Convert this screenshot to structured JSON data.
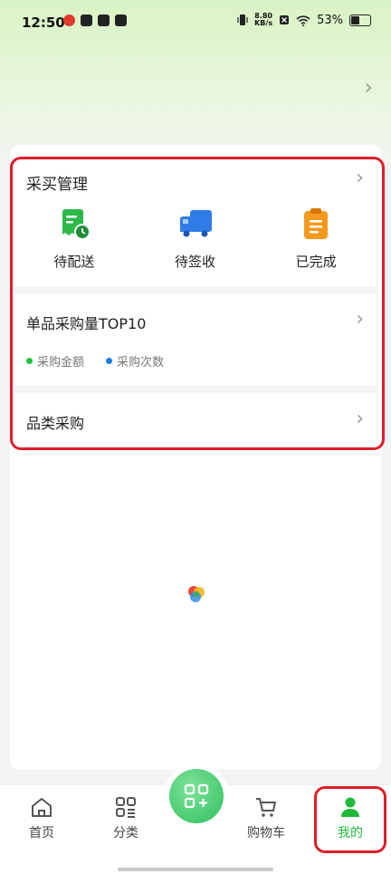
{
  "status_bar": {
    "time": "12:50",
    "net_speed_value": "8.80",
    "net_speed_unit": "KB/s",
    "battery": "53%"
  },
  "purchase_card": {
    "title": "采买管理",
    "items": [
      {
        "label": "待配送",
        "icon": "delivery-receipt-icon",
        "color": "#2db84a"
      },
      {
        "label": "待签收",
        "icon": "truck-icon",
        "color": "#2f7be8"
      },
      {
        "label": "已完成",
        "icon": "clipboard-icon",
        "color": "#f39a1e"
      }
    ]
  },
  "top10_card": {
    "title": "单品采购量TOP10",
    "legend": [
      {
        "label": "采购金额",
        "color": "#22c33a"
      },
      {
        "label": "采购次数",
        "color": "#1a7fe0"
      }
    ]
  },
  "category_card": {
    "title": "品类采购"
  },
  "tabbar": {
    "accent": "#22b83a",
    "tabs": [
      {
        "label": "首页",
        "icon": "home-icon"
      },
      {
        "label": "分类",
        "icon": "category-grid-icon"
      },
      {
        "label": "",
        "icon": "scan-icon"
      },
      {
        "label": "购物车",
        "icon": "cart-icon"
      },
      {
        "label": "我的",
        "icon": "user-icon",
        "active": true
      }
    ]
  }
}
